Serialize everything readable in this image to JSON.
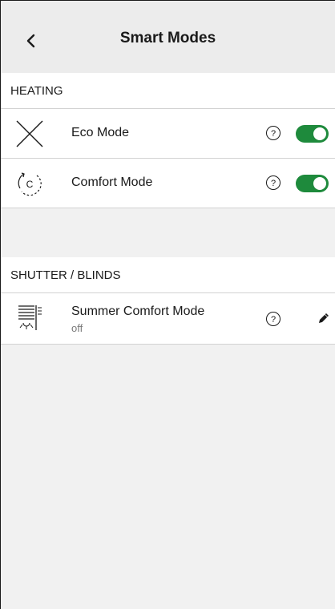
{
  "header": {
    "title": "Smart Modes"
  },
  "heating": {
    "title": "HEATING",
    "items": [
      {
        "label": "Eco Mode",
        "toggle_on": true
      },
      {
        "label": "Comfort Mode",
        "icon_text": "C",
        "toggle_on": true
      }
    ]
  },
  "shutter": {
    "title": "SHUTTER / BLINDS",
    "items": [
      {
        "label": "Summer Comfort Mode",
        "status": "off"
      }
    ]
  },
  "colors": {
    "accent": "#1e8a3c",
    "background": "#f1f1f1",
    "header_bg": "#ececec"
  },
  "icons": [
    "back-chevron-icon",
    "eco-mode-icon",
    "comfort-mode-icon",
    "help-icon",
    "blinds-sun-icon",
    "edit-pencil-icon"
  ]
}
